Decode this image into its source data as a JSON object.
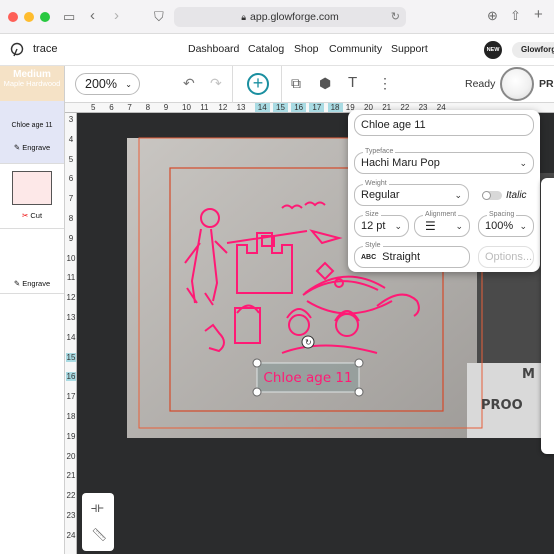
{
  "browser": {
    "url": "app.glowforge.com"
  },
  "nav": {
    "logo": "trace",
    "links": [
      "Dashboard",
      "Catalog",
      "Shop",
      "Community",
      "Support"
    ],
    "new_badge": "NEW",
    "account": "Glowforge"
  },
  "toolbar": {
    "zoom": "200%",
    "status": "Ready",
    "pro_label": "PR"
  },
  "left_panel": {
    "material_grade": "Medium",
    "material_name": "Maple Hardwood",
    "items": [
      {
        "preview": "Chloe age 11",
        "operation": "Engrave"
      },
      {
        "operation": "Cut"
      },
      {
        "operation": "Engrave"
      }
    ]
  },
  "rulers": {
    "h": [
      "5",
      "6",
      "7",
      "8",
      "9",
      "10",
      "11",
      "12",
      "13",
      "14",
      "15",
      "16",
      "17",
      "18",
      "19",
      "20",
      "21",
      "22",
      "23",
      "24"
    ],
    "v": [
      "3",
      "4",
      "5",
      "6",
      "7",
      "8",
      "9",
      "10",
      "11",
      "12",
      "13",
      "14",
      "15",
      "16",
      "17",
      "18",
      "19",
      "20",
      "21",
      "22",
      "23",
      "24"
    ]
  },
  "design": {
    "selected_text": "Chloe age 11"
  },
  "canvas_labels": {
    "pro_text": "PROO",
    "m_text": "M"
  },
  "text_panel": {
    "text_value": "Chloe age 11",
    "typeface_label": "Typeface",
    "typeface": "Hachi Maru Pop",
    "weight_label": "Weight",
    "weight": "Regular",
    "italic": "Italic",
    "size_label": "Size",
    "size": "12 pt",
    "alignment_label": "Alignment",
    "spacing_label": "Spacing",
    "spacing": "100%",
    "style_label": "Style",
    "style_icon_text": "ABC",
    "style": "Straight",
    "options": "Options..."
  },
  "colors": {
    "accent": "#1a8fa0",
    "design_pink": "#ff1a75",
    "material_bg": "#f5e2c6",
    "cut_bg": "#fde8e8"
  }
}
